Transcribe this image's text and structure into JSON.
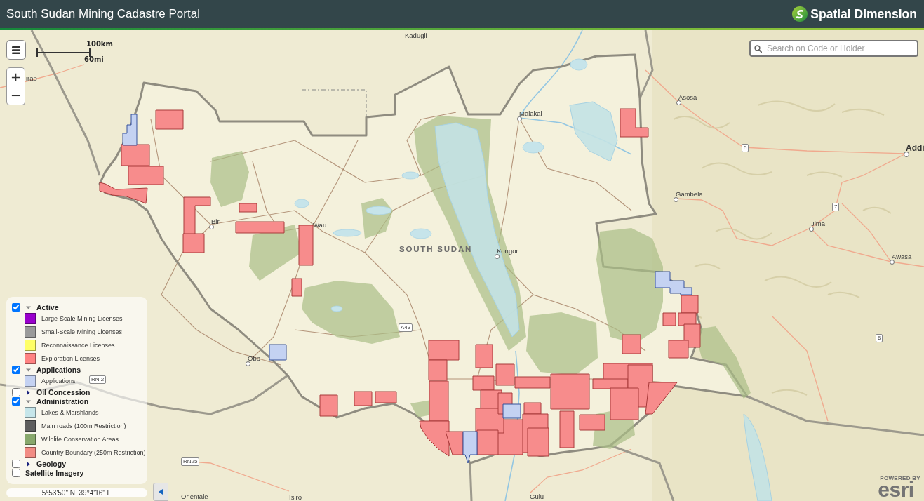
{
  "header": {
    "title": "South Sudan Mining Cadastre Portal",
    "brand": "Spatial Dimension"
  },
  "map_controls": {
    "zoom_in": "+",
    "zoom_out": "−"
  },
  "scale_bar": {
    "metric": "100km",
    "imperial": "60mi"
  },
  "search": {
    "placeholder": "Search on Code or Holder"
  },
  "map_labels": [
    {
      "text": "Kadugli",
      "kind": "place"
    },
    {
      "text": "irao",
      "kind": "place"
    },
    {
      "text": "Asosa",
      "kind": "city"
    },
    {
      "text": "Malakal",
      "kind": "city"
    },
    {
      "text": "5",
      "kind": "shield"
    },
    {
      "text": "Addi",
      "kind": "capital"
    },
    {
      "text": "Gambela",
      "kind": "city"
    },
    {
      "text": "7",
      "kind": "shield"
    },
    {
      "text": "Biri",
      "kind": "city"
    },
    {
      "text": "Wau",
      "kind": "place"
    },
    {
      "text": "Jima",
      "kind": "city"
    },
    {
      "text": "SOUTH SUDAN",
      "kind": "country"
    },
    {
      "text": "Kongor",
      "kind": "city"
    },
    {
      "text": "Awasa",
      "kind": "city"
    },
    {
      "text": "A43",
      "kind": "shield"
    },
    {
      "text": "6",
      "kind": "shield"
    },
    {
      "text": "Obo",
      "kind": "city"
    },
    {
      "text": "RN 2",
      "kind": "shield"
    },
    {
      "text": "RN25",
      "kind": "shield"
    },
    {
      "text": "Orientale",
      "kind": "place"
    },
    {
      "text": "Isiro",
      "kind": "place"
    },
    {
      "text": "Gulu",
      "kind": "place"
    }
  ],
  "legend": {
    "groups": [
      {
        "label": "Active",
        "checked": true,
        "kind": "group",
        "expanded": true,
        "items": [
          {
            "label": "Large-Scale Mining Licenses",
            "color": "#9900cc"
          },
          {
            "label": "Small-Scale Mining Licenses",
            "color": "#9a9a9a"
          },
          {
            "label": "Reconnaissance Licenses",
            "color": "#ffff66"
          },
          {
            "label": "Exploration Licenses",
            "color": "#ff8282"
          }
        ]
      },
      {
        "label": "Applications",
        "checked": true,
        "kind": "group",
        "expanded": true,
        "items": [
          {
            "label": "Applications",
            "color": "#c4d2f2"
          }
        ]
      },
      {
        "label": "Oil Concession",
        "checked": false,
        "kind": "group",
        "expanded": false
      },
      {
        "label": "Administration",
        "checked": true,
        "kind": "group",
        "expanded": true,
        "items": [
          {
            "label": "Lakes & Marshlands",
            "color": "#c6e6ea"
          },
          {
            "label": "Main roads (100m Restriction)",
            "color": "#5e5e5e"
          },
          {
            "label": "Wildlife Conservation Areas",
            "color": "#88a86c"
          },
          {
            "label": "Country Boundary (250m Restriction)",
            "color": "#f28c84"
          }
        ]
      },
      {
        "label": "Geology",
        "checked": false,
        "kind": "group",
        "expanded": false
      },
      {
        "label": "Satellite Imagery",
        "checked": false,
        "kind": "layer"
      }
    ]
  },
  "coordinates": "5°53'50\" N  39°4'16\" E",
  "attribution": {
    "caption": "POWERED BY",
    "wordmark": "esri"
  }
}
